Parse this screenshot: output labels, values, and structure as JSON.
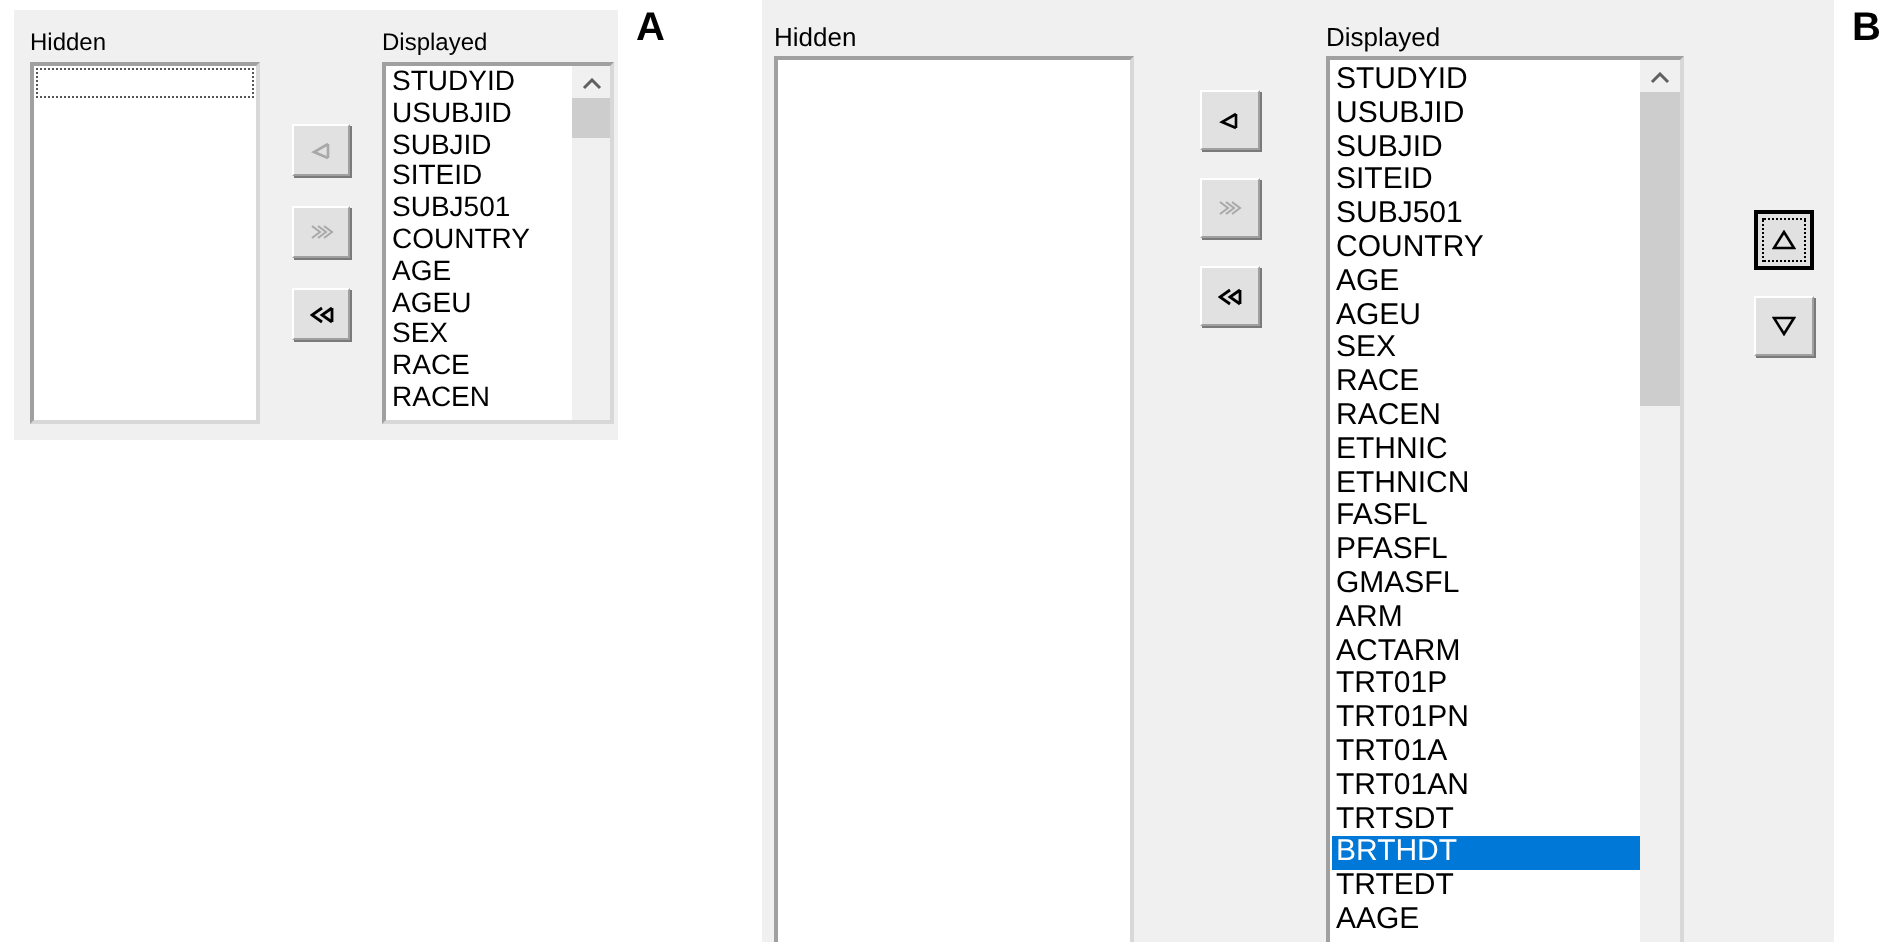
{
  "panels": [
    {
      "label": "A",
      "hidden": {
        "title": "Hidden",
        "focused": true
      },
      "move_buttons": [
        {
          "kind": "move-left",
          "disabled": true
        },
        {
          "kind": "move-all-right",
          "disabled": true
        },
        {
          "kind": "move-all-left",
          "disabled": false
        }
      ],
      "displayed": {
        "title": "Displayed",
        "items": [
          {
            "text": "STUDYID",
            "selected": false
          },
          {
            "text": "USUBJID",
            "selected": false
          },
          {
            "text": "SUBJID",
            "selected": false
          },
          {
            "text": "SITEID",
            "selected": false
          },
          {
            "text": "SUBJ501",
            "selected": false
          },
          {
            "text": "COUNTRY",
            "selected": false
          },
          {
            "text": "AGE",
            "selected": false
          },
          {
            "text": "AGEU",
            "selected": false
          },
          {
            "text": "SEX",
            "selected": false
          },
          {
            "text": "RACE",
            "selected": false
          },
          {
            "text": "RACEN",
            "selected": false
          }
        ]
      }
    },
    {
      "label": "B",
      "hidden": {
        "title": "Hidden",
        "focused": false
      },
      "move_buttons": [
        {
          "kind": "move-left",
          "disabled": false
        },
        {
          "kind": "move-all-right",
          "disabled": true
        },
        {
          "kind": "move-all-left",
          "disabled": false
        }
      ],
      "displayed": {
        "title": "Displayed",
        "items": [
          {
            "text": "STUDYID",
            "selected": false
          },
          {
            "text": "USUBJID",
            "selected": false
          },
          {
            "text": "SUBJID",
            "selected": false
          },
          {
            "text": "SITEID",
            "selected": false
          },
          {
            "text": "SUBJ501",
            "selected": false
          },
          {
            "text": "COUNTRY",
            "selected": false
          },
          {
            "text": "AGE",
            "selected": false
          },
          {
            "text": "AGEU",
            "selected": false
          },
          {
            "text": "SEX",
            "selected": false
          },
          {
            "text": "RACE",
            "selected": false
          },
          {
            "text": "RACEN",
            "selected": false
          },
          {
            "text": "ETHNIC",
            "selected": false
          },
          {
            "text": "ETHNICN",
            "selected": false
          },
          {
            "text": "FASFL",
            "selected": false
          },
          {
            "text": "PFASFL",
            "selected": false
          },
          {
            "text": "GMASFL",
            "selected": false
          },
          {
            "text": "ARM",
            "selected": false
          },
          {
            "text": "ACTARM",
            "selected": false
          },
          {
            "text": "TRT01P",
            "selected": false
          },
          {
            "text": "TRT01PN",
            "selected": false
          },
          {
            "text": "TRT01A",
            "selected": false
          },
          {
            "text": "TRT01AN",
            "selected": false
          },
          {
            "text": "TRTSDT",
            "selected": false
          },
          {
            "text": "BRTHDT",
            "selected": true
          },
          {
            "text": "TRTEDT",
            "selected": false
          },
          {
            "text": "AAGE",
            "selected": false
          }
        ]
      },
      "order_buttons": [
        {
          "kind": "move-up",
          "focused": true
        },
        {
          "kind": "move-down",
          "focused": false
        }
      ]
    }
  ]
}
